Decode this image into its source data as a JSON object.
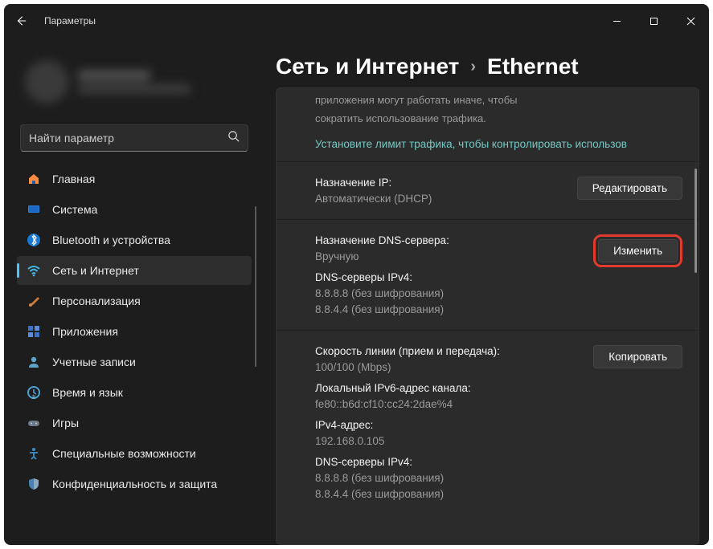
{
  "title": "Параметры",
  "search": {
    "placeholder": "Найти параметр"
  },
  "nav": [
    {
      "label": "Главная",
      "icon": "home"
    },
    {
      "label": "Система",
      "icon": "system"
    },
    {
      "label": "Bluetooth и устройства",
      "icon": "bluetooth"
    },
    {
      "label": "Сеть и Интернет",
      "icon": "wifi",
      "active": true
    },
    {
      "label": "Персонализация",
      "icon": "brush"
    },
    {
      "label": "Приложения",
      "icon": "apps"
    },
    {
      "label": "Учетные записи",
      "icon": "account"
    },
    {
      "label": "Время и язык",
      "icon": "time"
    },
    {
      "label": "Игры",
      "icon": "games"
    },
    {
      "label": "Специальные возможности",
      "icon": "access"
    },
    {
      "label": "Конфиденциальность и защита",
      "icon": "shield"
    }
  ],
  "breadcrumb": {
    "parent": "Сеть и Интернет",
    "current": "Ethernet"
  },
  "top_note": {
    "line1": "приложения могут работать иначе, чтобы",
    "line2": "сократить использование трафика.",
    "link": "Установите лимит трафика, чтобы контролировать использов"
  },
  "sections": {
    "ip": {
      "title": "Назначение IP:",
      "value": "Автоматически (DHCP)",
      "button": "Редактировать"
    },
    "dns": {
      "title": "Назначение DNS-сервера:",
      "value": "Вручную",
      "sub": "DNS-серверы IPv4:",
      "v1": "8.8.8.8 (без шифрования)",
      "v2": "8.8.4.4 (без шифрования)",
      "button": "Изменить"
    },
    "speed": {
      "l1": "Скорость линии (прием и передача):",
      "v1": "100/100 (Mbps)",
      "l2": "Локальный IPv6-адрес канала:",
      "v2": "fe80::b6d:cf10:cc24:2dae%4",
      "l3": "IPv4-адрес:",
      "v3": "192.168.0.105",
      "l4": "DNS-серверы IPv4:",
      "v4": "8.8.8.8 (без шифрования)",
      "v5": "8.8.4.4 (без шифрования)",
      "button": "Копировать"
    }
  }
}
